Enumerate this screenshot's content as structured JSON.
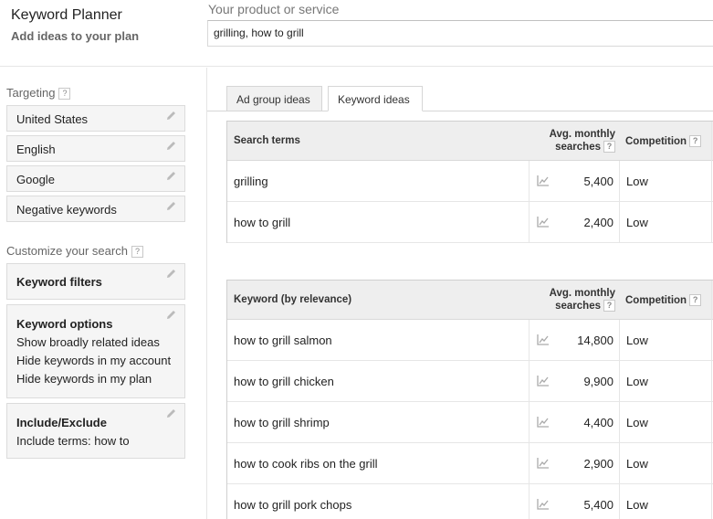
{
  "header": {
    "title": "Keyword Planner",
    "subtitle": "Add ideas to your plan",
    "product_label": "Your product or service",
    "product_value": "grilling, how to grill"
  },
  "sidebar": {
    "targeting_label": "Targeting",
    "help_glyph": "?",
    "targeting_items": [
      {
        "label": "United States"
      },
      {
        "label": "English"
      },
      {
        "label": "Google"
      },
      {
        "label": "Negative keywords"
      }
    ],
    "customize_label": "Customize your search",
    "keyword_filters": {
      "title": "Keyword filters"
    },
    "keyword_options": {
      "title": "Keyword options",
      "lines": [
        "Show broadly related ideas",
        "Hide keywords in my account",
        "Hide keywords in my plan"
      ]
    },
    "include_exclude": {
      "title": "Include/Exclude",
      "line": "Include terms: how to"
    }
  },
  "tabs": [
    {
      "label": "Ad group ideas",
      "active": false
    },
    {
      "label": "Keyword ideas",
      "active": true
    }
  ],
  "search_terms_table": {
    "col_term": "Search terms",
    "col_avg": "Avg. monthly searches",
    "col_competition": "Competition",
    "rows": [
      {
        "term": "grilling",
        "searches": "5,400",
        "competition": "Low"
      },
      {
        "term": "how to grill",
        "searches": "2,400",
        "competition": "Low"
      }
    ]
  },
  "ideas_table": {
    "col_term": "Keyword (by relevance)",
    "col_avg": "Avg. monthly searches",
    "col_competition": "Competition",
    "rows": [
      {
        "term": "how to grill salmon",
        "searches": "14,800",
        "competition": "Low"
      },
      {
        "term": "how to grill chicken",
        "searches": "9,900",
        "competition": "Low"
      },
      {
        "term": "how to grill shrimp",
        "searches": "4,400",
        "competition": "Low"
      },
      {
        "term": "how to cook ribs on the grill",
        "searches": "2,900",
        "competition": "Low"
      },
      {
        "term": "how to grill pork chops",
        "searches": "5,400",
        "competition": "Low"
      }
    ]
  },
  "icons": {
    "edit": "pencil-icon",
    "trend": "trend-chart-icon",
    "help": "help-icon"
  }
}
